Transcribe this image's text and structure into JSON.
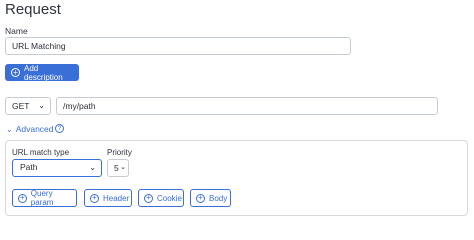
{
  "section": {
    "title": "Request"
  },
  "name_field": {
    "label": "Name",
    "value": "URL Matching"
  },
  "add_description": {
    "label": "Add description",
    "icon": "plus-circle-icon"
  },
  "method": {
    "value": "GET"
  },
  "path": {
    "value": "/my/path"
  },
  "advanced": {
    "label": "Advanced",
    "expanded": true
  },
  "advanced_panel": {
    "url_match": {
      "label": "URL match type",
      "value": "Path"
    },
    "priority": {
      "label": "Priority",
      "value": "5"
    },
    "buttons": [
      {
        "label": "Query param"
      },
      {
        "label": "Header"
      },
      {
        "label": "Cookie"
      },
      {
        "label": "Body"
      }
    ]
  },
  "colors": {
    "accent": "#3b6fd8",
    "border": "#c7ccd3"
  }
}
